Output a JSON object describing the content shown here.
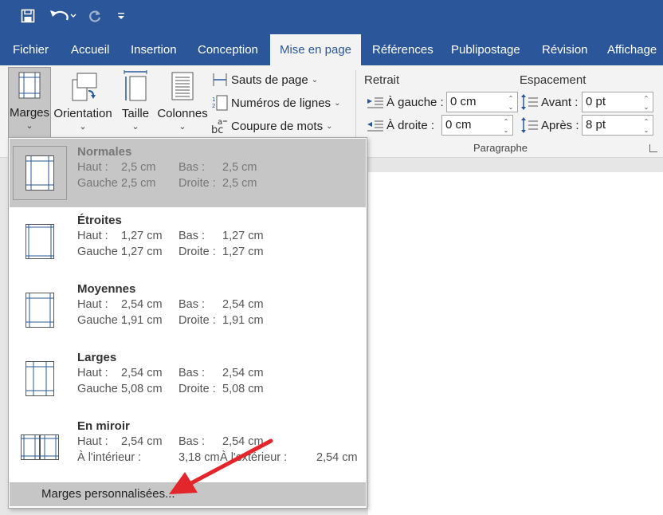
{
  "qat": {
    "save_icon": "save-icon",
    "undo_icon": "undo-icon",
    "redo_icon": "redo-icon",
    "customize_icon": "customize-qat-icon"
  },
  "tabs": [
    {
      "label": "Fichier"
    },
    {
      "label": "Accueil"
    },
    {
      "label": "Insertion"
    },
    {
      "label": "Conception"
    },
    {
      "label": "Mise en page"
    },
    {
      "label": "Références"
    },
    {
      "label": "Publipostage"
    },
    {
      "label": "Révision"
    },
    {
      "label": "Affichage"
    }
  ],
  "ribbon": {
    "marges": "Marges",
    "orientation": "Orientation",
    "taille": "Taille",
    "colonnes": "Colonnes",
    "sauts": "Sauts de page",
    "numeros": "Numéros de lignes",
    "coupure": "Coupure de mots",
    "retrait_title": "Retrait",
    "espacement_title": "Espacement",
    "gauche_label": "À gauche :",
    "gauche_value": "0 cm",
    "droite_label": "À droite :",
    "droite_value": "0 cm",
    "avant_label": "Avant :",
    "avant_value": "0 pt",
    "apres_label": "Après :",
    "apres_value": "8 pt",
    "paragraphe_group": "Paragraphe"
  },
  "margins_menu": {
    "items": [
      {
        "name": "Normales",
        "haut_label": "Haut :",
        "haut": "2,5 cm",
        "bas_label": "Bas :",
        "bas": "2,5 cm",
        "gauche_label": "Gauche :",
        "gauche": "2,5 cm",
        "droite_label": "Droite :",
        "droite": "2,5 cm"
      },
      {
        "name": "Étroites",
        "haut_label": "Haut :",
        "haut": "1,27 cm",
        "bas_label": "Bas :",
        "bas": "1,27 cm",
        "gauche_label": "Gauche :",
        "gauche": "1,27 cm",
        "droite_label": "Droite :",
        "droite": "1,27 cm"
      },
      {
        "name": "Moyennes",
        "haut_label": "Haut :",
        "haut": "2,54 cm",
        "bas_label": "Bas :",
        "bas": "2,54 cm",
        "gauche_label": "Gauche :",
        "gauche": "1,91 cm",
        "droite_label": "Droite :",
        "droite": "1,91 cm"
      },
      {
        "name": "Larges",
        "haut_label": "Haut :",
        "haut": "2,54 cm",
        "bas_label": "Bas :",
        "bas": "2,54 cm",
        "gauche_label": "Gauche :",
        "gauche": "5,08 cm",
        "droite_label": "Droite :",
        "droite": "5,08 cm"
      },
      {
        "name": "En miroir",
        "haut_label": "Haut :",
        "haut": "2,54 cm",
        "bas_label": "Bas :",
        "bas": "2,54 cm",
        "gauche_label": "À l'intérieur :",
        "gauche": "3,18 cm",
        "droite_label": "À l'extérieur :",
        "droite": "2,54 cm"
      }
    ],
    "custom": "Marges personnalisées..."
  },
  "colors": {
    "accent": "#2b579a",
    "arrow": "#e3262b"
  }
}
